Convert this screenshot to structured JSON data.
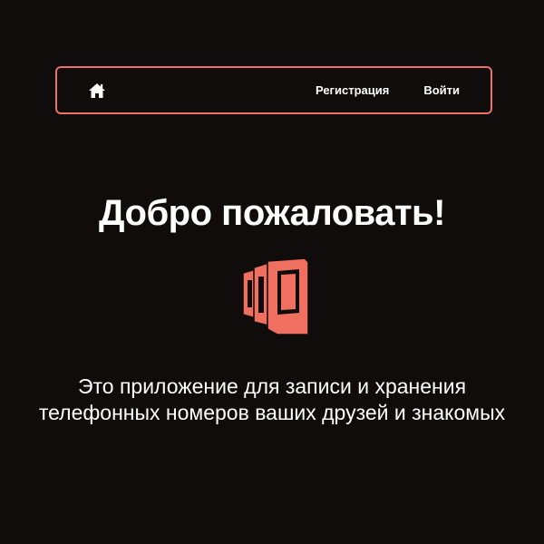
{
  "navbar": {
    "home_icon": "home-icon",
    "links": [
      {
        "label": "Регистрация"
      },
      {
        "label": "Войти"
      }
    ],
    "border_color": "#ef6f60"
  },
  "main": {
    "title": "Добро пожаловать!",
    "logo_icon": "stacked-pages-logo-icon",
    "description": "Это приложение для записи и хранения телефонных номеров ваших друзей и знакомых"
  },
  "colors": {
    "background": "#100c0b",
    "accent": "#ef6f60",
    "text": "#ffffff"
  }
}
